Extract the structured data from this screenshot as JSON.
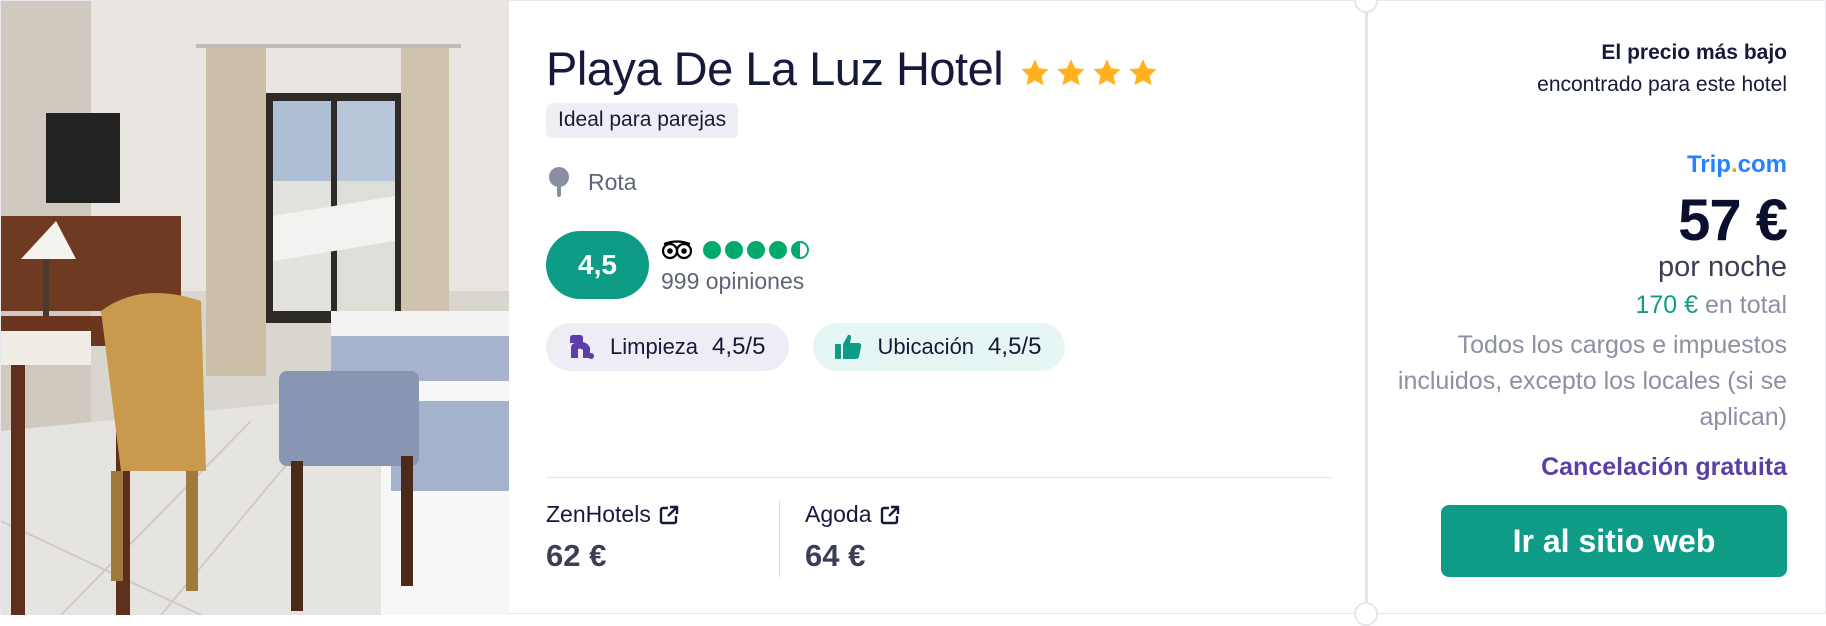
{
  "hotel": {
    "name": "Playa De La Luz Hotel",
    "star_rating": 4,
    "tag": "Ideal para parejas",
    "location": "Rota"
  },
  "rating": {
    "score": "4,5",
    "tripadvisor_bubbles": 4.5,
    "reviews": "999 opiniones"
  },
  "pills": [
    {
      "icon": "cleaning-icon",
      "label": "Limpieza",
      "value": "4,5",
      "suffix": "/5"
    },
    {
      "icon": "thumbs-up-icon",
      "label": "Ubicación",
      "value": "4,5",
      "suffix": "/5"
    }
  ],
  "offers": [
    {
      "provider": "ZenHotels",
      "price": "62 €"
    },
    {
      "provider": "Agoda",
      "price": "64 €"
    }
  ],
  "side": {
    "lowest_bold": "El precio más bajo",
    "lowest_sub": "encontrado para este hotel",
    "provider_name": "Trip",
    "provider_dot": ".",
    "provider_tld": "com",
    "price": "57 €",
    "per_night": "por noche",
    "total_amount": "170 €",
    "total_label": " en total",
    "taxes": "Todos los cargos e impuestos incluidos, excepto los locales (si se aplican)",
    "cancellation": "Cancelación gratuita",
    "cta": "Ir al sitio web"
  },
  "colors": {
    "accent": "#0f9c86",
    "star": "#ffb21d",
    "tripadvisor_green": "#00aa6c",
    "cancellation": "#5b3fa6",
    "trip_blue": "#2681ff"
  }
}
